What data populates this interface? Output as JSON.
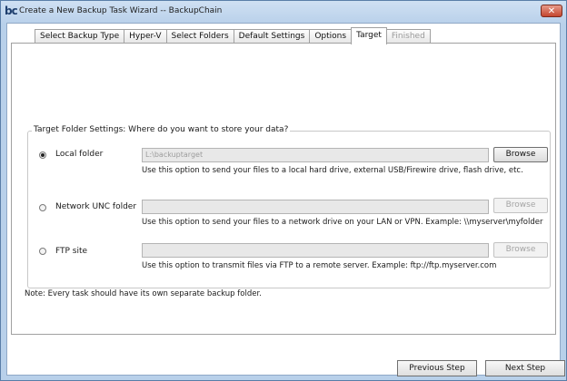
{
  "window": {
    "logo": "bc",
    "title": "Create a New Backup Task Wizard -- BackupChain",
    "close_symbol": "✕"
  },
  "tabs": [
    {
      "label": "Select Backup Type",
      "state": "normal"
    },
    {
      "label": "Hyper-V",
      "state": "normal"
    },
    {
      "label": "Select Folders",
      "state": "normal"
    },
    {
      "label": "Default Settings",
      "state": "normal"
    },
    {
      "label": "Options",
      "state": "normal"
    },
    {
      "label": "Target",
      "state": "active"
    },
    {
      "label": "Finished",
      "state": "disabled"
    }
  ],
  "target": {
    "group_title": "Target Folder Settings: Where do you want to store your data?",
    "options": {
      "local": {
        "label": "Local folder",
        "selected": true,
        "value": "L:\\backuptarget",
        "browse": "Browse",
        "browse_enabled": true,
        "hint": "Use this option to send your files to a local hard drive, external USB/Firewire drive, flash drive, etc."
      },
      "unc": {
        "label": "Network UNC folder",
        "selected": false,
        "value": "",
        "browse": "Browse",
        "browse_enabled": false,
        "hint": "Use this option to send your files to a network drive on your LAN or VPN. Example: \\\\myserver\\myfolder"
      },
      "ftp": {
        "label": "FTP site",
        "selected": false,
        "value": "",
        "browse": "Browse",
        "browse_enabled": false,
        "hint": "Use this option to transmit files via FTP to a remote server. Example: ftp://ftp.myserver.com"
      }
    },
    "note": "Note: Every task should have its own separate backup folder."
  },
  "footer": {
    "previous": "Previous Step",
    "next": "Next Step"
  }
}
